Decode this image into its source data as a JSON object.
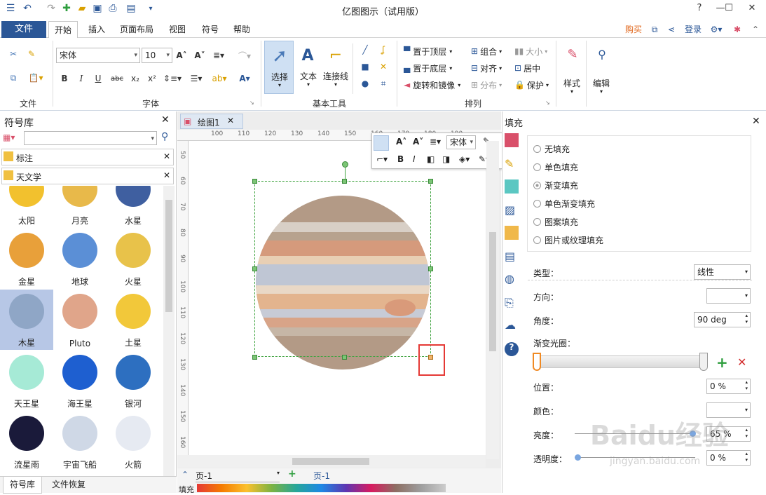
{
  "app": {
    "title": "亿图图示（试用版）"
  },
  "menu": {
    "file": "文件",
    "tabs": [
      "开始",
      "插入",
      "页面布局",
      "视图",
      "符号",
      "帮助"
    ],
    "buy": "购买",
    "login": "登录"
  },
  "ribbon": {
    "groups": {
      "file": "文件",
      "font": "字体",
      "basic_tools": "基本工具",
      "arrange": "排列"
    },
    "font_name": "宋体",
    "font_size": "10",
    "select": "选择",
    "text": "文本",
    "connector": "连接线",
    "bring_front": "置于顶层",
    "send_back": "置于底层",
    "rotate_mirror": "旋转和镜像",
    "group": "组合",
    "align": "对齐",
    "distribute": "分布",
    "size": "大小",
    "center": "居中",
    "protect": "保护",
    "style": "样式",
    "edit": "编辑"
  },
  "library": {
    "title": "符号库",
    "search_placeholder": "",
    "sections": [
      "标注",
      "天文学"
    ],
    "symbols": [
      {
        "label": "太阳",
        "color": "#f2c12e"
      },
      {
        "label": "月亮",
        "color": "#e8b94a"
      },
      {
        "label": "水星",
        "color": "#3f5fa0"
      },
      {
        "label": "金星",
        "color": "#e8a03a"
      },
      {
        "label": "地球",
        "color": "#5b8fd6"
      },
      {
        "label": "火星",
        "color": "#e8c24a"
      },
      {
        "label": "木星",
        "color": "#8fa6c6"
      },
      {
        "label": "Pluto",
        "color": "#e0a58a"
      },
      {
        "label": "土星",
        "color": "#f2c83a"
      },
      {
        "label": "天王星",
        "color": "#a6ead6"
      },
      {
        "label": "海王星",
        "color": "#1e5fd0"
      },
      {
        "label": "银河",
        "color": "#2d6fc0"
      },
      {
        "label": "流星雨",
        "color": "#1a1a3a"
      },
      {
        "label": "宇宙飞船",
        "color": "#cfd8e6"
      },
      {
        "label": "火箭",
        "color": "#e6eaf2"
      }
    ],
    "bottom_tabs": [
      "符号库",
      "文件恢复"
    ]
  },
  "canvas": {
    "doc_tab": "绘图1",
    "ruler_h": [
      "100",
      "110",
      "120",
      "130",
      "140",
      "150",
      "160",
      "170",
      "180",
      "190"
    ],
    "ruler_v": [
      "50",
      "60",
      "70",
      "80",
      "90",
      "100",
      "110",
      "120",
      "130",
      "140",
      "150",
      "160"
    ],
    "mini_font": "宋体"
  },
  "status": {
    "page_combo": "页-1",
    "page_tab": "页-1",
    "fill_label": "填充"
  },
  "fill_panel": {
    "title": "填充",
    "options": [
      "无填充",
      "单色填充",
      "渐变填充",
      "单色渐变填充",
      "图案填充",
      "图片或纹理填充"
    ],
    "selected": "渐变填充",
    "type_label": "类型：",
    "type_value": "线性",
    "direction_label": "方向：",
    "angle_label": "角度：",
    "angle_value": "90 deg",
    "aperture_label": "渐变光圈：",
    "position_label": "位置：",
    "position_value": "0 %",
    "color_label": "颜色：",
    "brightness_label": "亮度：",
    "brightness_value": "65 %",
    "transparency_label": "透明度：",
    "transparency_value": "0 %"
  },
  "watermark": {
    "text": "Baidu经验",
    "url": "jingyan.baidu.com"
  }
}
